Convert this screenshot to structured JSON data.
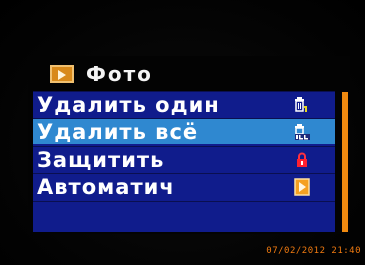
{
  "title": {
    "icon": "photo-play-icon",
    "text": "Фото"
  },
  "menu": {
    "items": [
      {
        "label": "Удалить один",
        "icon": "delete-one-trash-icon",
        "selected": false
      },
      {
        "label": "Удалить всё",
        "icon": "delete-all-trash-icon",
        "selected": true
      },
      {
        "label": "Защитить",
        "icon": "lock-icon",
        "selected": false
      },
      {
        "label": "Автоматич",
        "icon": "play-icon",
        "selected": false
      },
      {
        "label": "",
        "icon": "",
        "selected": false
      }
    ]
  },
  "scrollbar": {
    "thumb_fraction": 1.0
  },
  "datestamp": "07/02/2012 21:40",
  "colors": {
    "menu_background": "#101c8c",
    "selected_background": "#2f88d0",
    "accent": "#f08a10",
    "text": "#ffffff"
  }
}
